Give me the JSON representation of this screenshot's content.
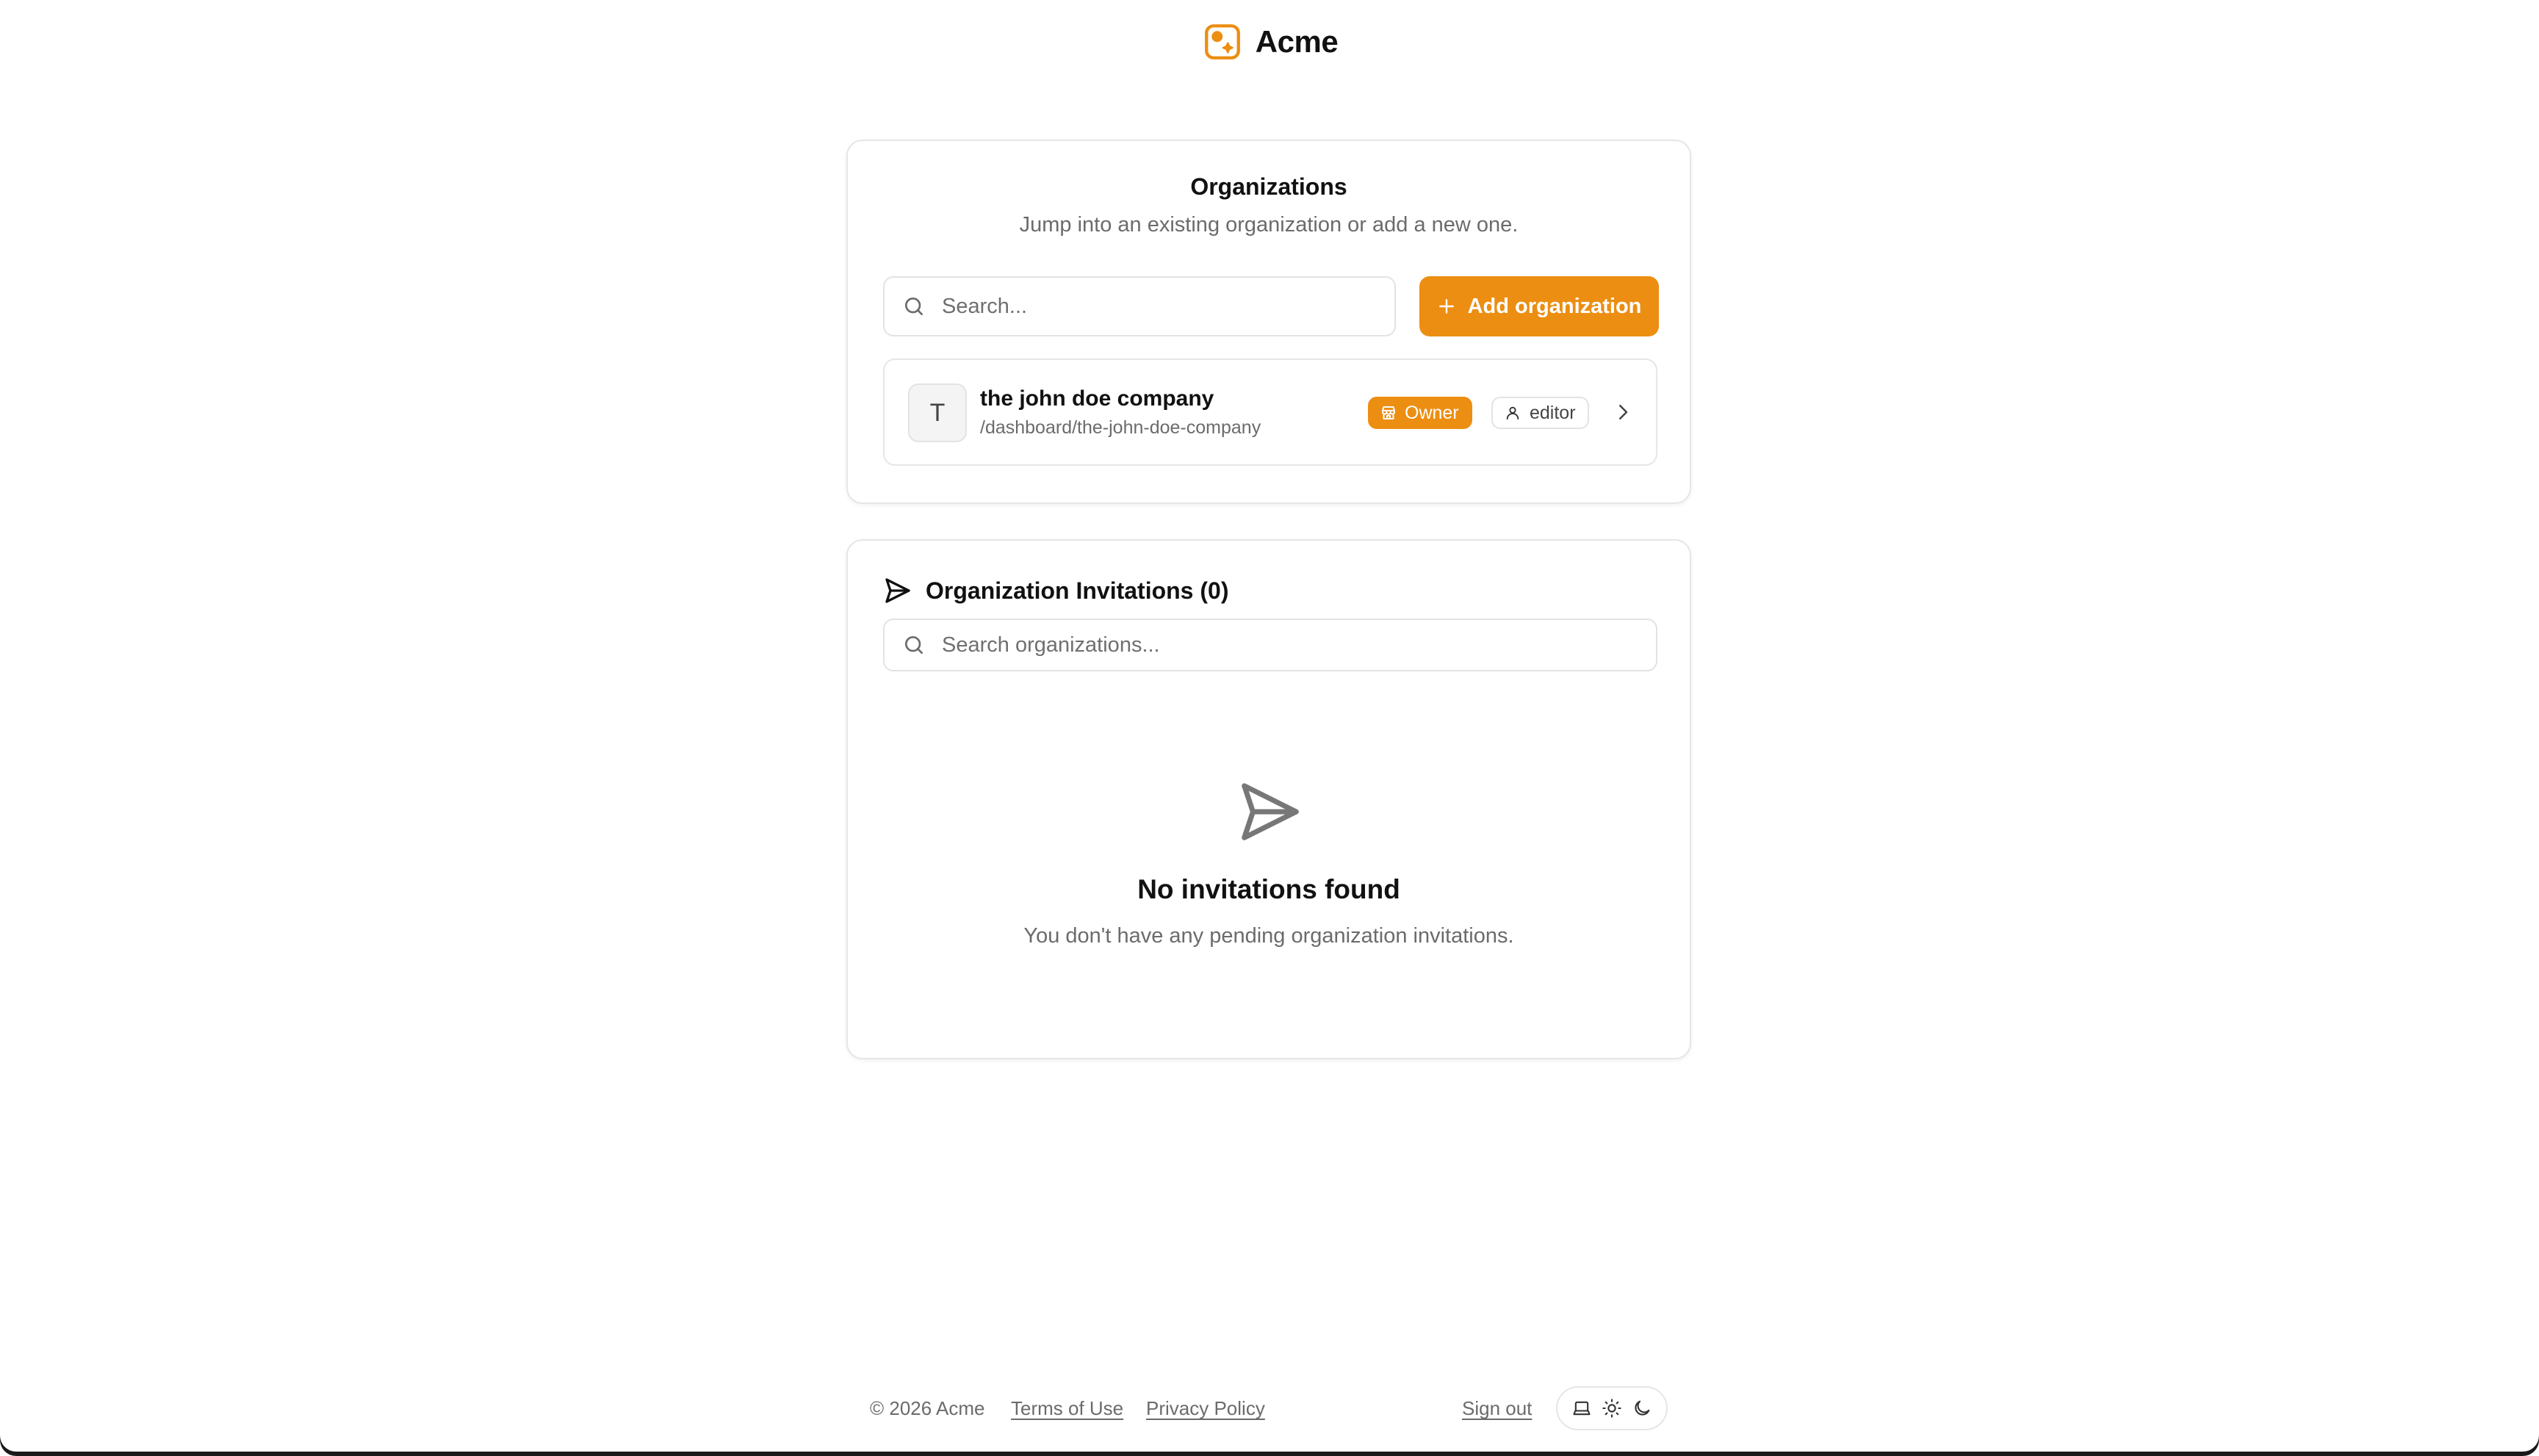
{
  "brand": {
    "name": "Acme",
    "accent": "#ec8e12"
  },
  "organizations_card": {
    "title": "Organizations",
    "subtitle": "Jump into an existing organization or add a new one.",
    "search_placeholder": "Search...",
    "add_button_label": "Add organization",
    "orgs": [
      {
        "initial": "T",
        "name": "the john doe company",
        "path": "/dashboard/the-john-doe-company",
        "owner_badge": "Owner",
        "role_badge": "editor"
      }
    ]
  },
  "invitations_card": {
    "title": "Organization Invitations (0)",
    "search_placeholder": "Search organizations...",
    "empty_title": "No invitations found",
    "empty_description": "You don't have any pending organization invitations."
  },
  "footer": {
    "copyright": "© 2026 Acme",
    "terms_label": "Terms of Use",
    "privacy_label": "Privacy Policy",
    "signout_label": "Sign out"
  },
  "icons": {
    "logo": "acme-logo-icon",
    "search": "search-icon",
    "plus": "plus-icon",
    "store": "store-icon",
    "user": "user-icon",
    "chevron": "chevron-right-icon",
    "send": "send-icon",
    "laptop": "laptop-icon",
    "sun": "sun-icon",
    "moon": "moon-icon"
  }
}
